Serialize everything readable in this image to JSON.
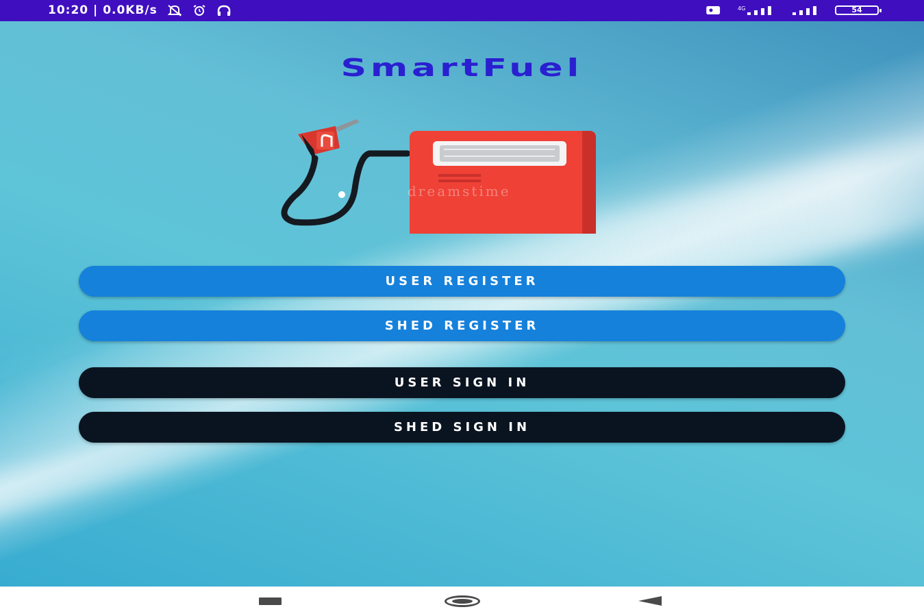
{
  "status_bar": {
    "time": "10:20",
    "speed": "0.0KB/s",
    "separator": "|",
    "battery": "54",
    "icons": [
      "mute-icon",
      "alarm-icon",
      "headset-icon",
      "screenshot-icon",
      "signal-icon",
      "signal-icon",
      "battery-icon"
    ]
  },
  "app": {
    "title": "SmartFuel",
    "illustration": "fuel-pump-icon",
    "watermark": "dreamstime"
  },
  "buttons": {
    "user_register": "USER REGISTER",
    "shed_register": "SHED REGISTER",
    "user_sign_in": "USER SIGN IN",
    "shed_sign_in": "SHED SIGN IN"
  },
  "nav_bar": {
    "icons": [
      "recents-icon",
      "home-icon",
      "back-icon"
    ]
  },
  "colors": {
    "status_bar": "#3f0fbf",
    "title": "#2a1fd1",
    "register_button": "#1681db",
    "sign_in_button": "#0a1420",
    "pump": "#ef4136"
  }
}
